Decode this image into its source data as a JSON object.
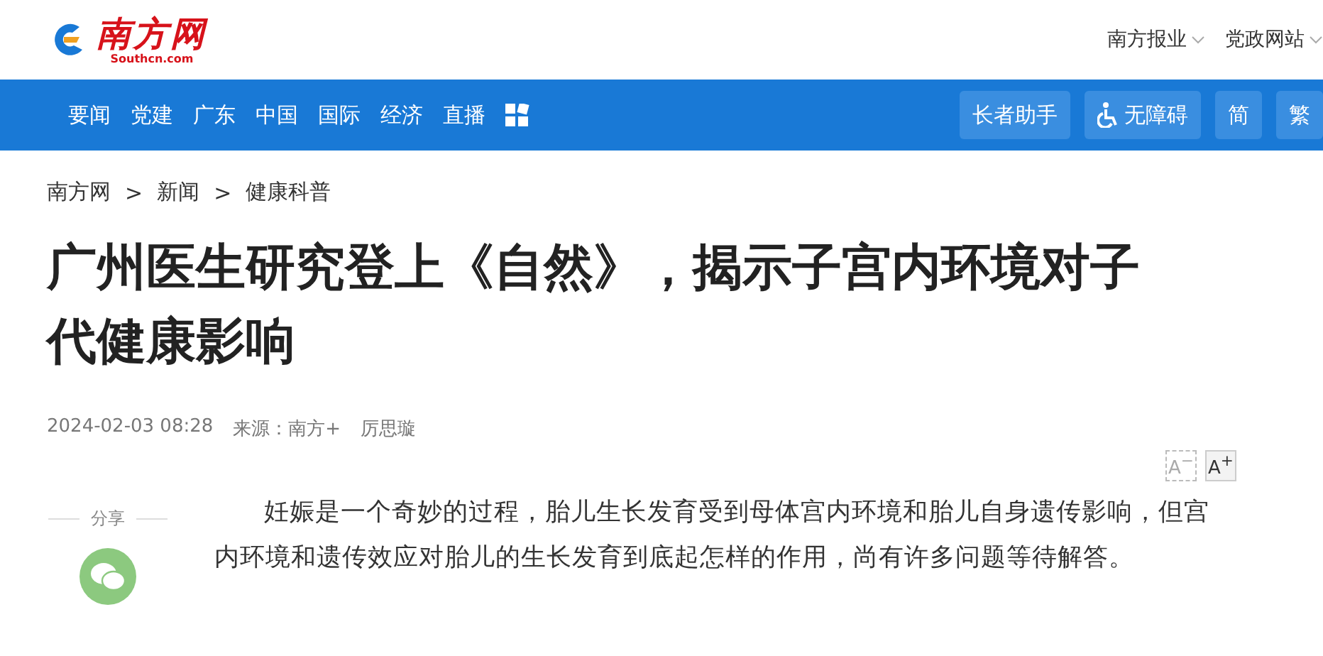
{
  "logo": {
    "name": "南方网",
    "domain": "Southcn.com"
  },
  "top_links": [
    {
      "label": "南方报业"
    },
    {
      "label": "党政网站"
    }
  ],
  "nav": {
    "items": [
      "要闻",
      "党建",
      "广东",
      "中国",
      "国际",
      "经济",
      "直播"
    ],
    "tools": [
      {
        "label": "长者助手",
        "kind": "text"
      },
      {
        "label": "无障碍",
        "kind": "accessibility"
      },
      {
        "label": "简",
        "kind": "text"
      },
      {
        "label": "繁",
        "kind": "text"
      }
    ]
  },
  "breadcrumb": [
    "南方网",
    "新闻",
    "健康科普"
  ],
  "breadcrumb_separator": ">",
  "article": {
    "title": "广州医生研究登上《自然》，揭示子宫内环境对子代健康影响",
    "date": "2024-02-03 08:28",
    "source": "来源：南方+",
    "author": "厉思璇",
    "font_buttons": [
      {
        "label": "A",
        "sign": "−",
        "disabled": true
      },
      {
        "label": "A",
        "sign": "+",
        "disabled": false
      }
    ],
    "paragraph": "妊娠是一个奇妙的过程，胎儿生长发育受到母体宫内环境和胎儿自身遗传影响，但宫内环境和遗传效应对胎儿的生长发育到底起怎样的作用，尚有许多问题等待解答。"
  },
  "share": {
    "label": "分享"
  }
}
